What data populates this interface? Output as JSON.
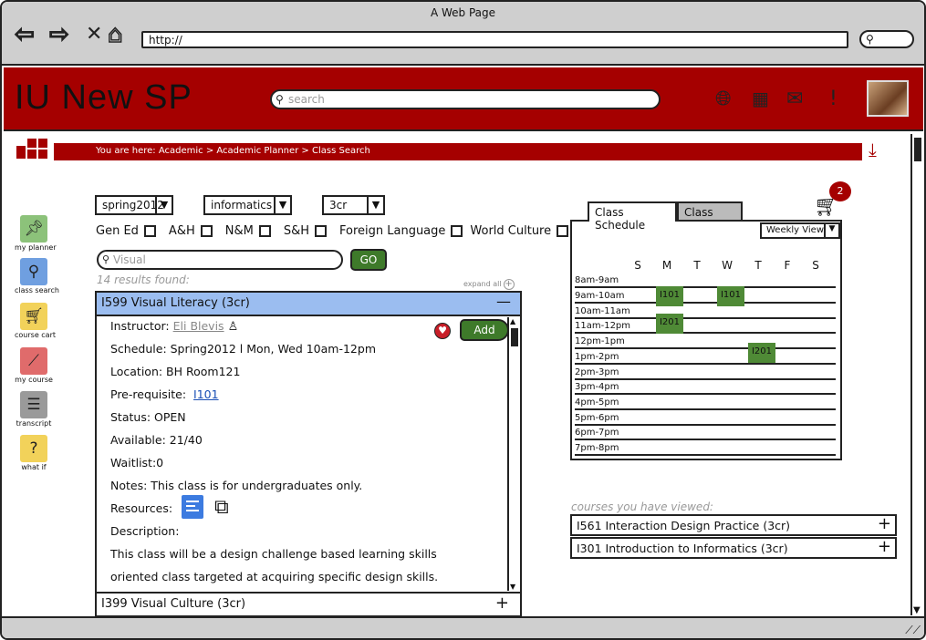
{
  "browser": {
    "window_title": "A Web Page",
    "url": "http://"
  },
  "header": {
    "app_title": "IU New SP",
    "search_placeholder": "search",
    "icons": [
      "globe-icon",
      "calendar-icon",
      "mail-icon",
      "alert-icon"
    ]
  },
  "breadcrumb": {
    "text": "You are here: Academic > Academic Planner > Class Search"
  },
  "sidebar": {
    "items": [
      {
        "label": "my planner",
        "icon": "pin-icon",
        "color": "#8cc27a"
      },
      {
        "label": "class search",
        "icon": "search-icon",
        "color": "#6f9fe0"
      },
      {
        "label": "course cart",
        "icon": "cart-icon",
        "color": "#f2d25a"
      },
      {
        "label": "my course",
        "icon": "chart-icon",
        "color": "#e06b6b"
      },
      {
        "label": "transcript",
        "icon": "list-icon",
        "color": "#9a9a9a"
      },
      {
        "label": "what if",
        "icon": "question-icon",
        "color": "#f2d25a"
      }
    ]
  },
  "filters": {
    "term": "spring2012",
    "department": "informatics",
    "credits": "3cr",
    "checkboxes": [
      "Gen Ed",
      "A&H",
      "N&M",
      "S&H",
      "Foreign Language",
      "World Culture"
    ],
    "search_placeholder": "Visual",
    "go_label": "GO",
    "results_count": "14 results found:",
    "expand_all": "expand all"
  },
  "course": {
    "title": "I599 Visual Literacy (3cr)",
    "instructor_label": "Instructor:",
    "instructor": "Eli Blevis",
    "schedule": "Schedule: Spring2012 l Mon, Wed 10am-12pm",
    "location": "Location: BH Room121",
    "prereq_label": "Pre-requisite:",
    "prereq": "I101",
    "status": "Status: OPEN",
    "available": "Available: 21/40",
    "waitlist": "Waitlist:0",
    "notes": "Notes: This class is for undergraduates only.",
    "resources_label": "Resources:",
    "description_label": "Description:",
    "description_line1": "This class will be a design challenge based learning skills",
    "description_line2": "oriented class targeted at acquiring specific design skills.",
    "add_label": "Add",
    "next_course": "I399 Visual Culture (3cr)"
  },
  "cart": {
    "count": "2"
  },
  "schedule": {
    "tab_active": "Class Schedule",
    "tab_inactive": "Class Map",
    "view": "Weekly View",
    "days": [
      "S",
      "M",
      "T",
      "W",
      "T",
      "F",
      "S"
    ],
    "times": [
      "8am-9am",
      "9am-10am",
      "10am-11am",
      "11am-12pm",
      "12pm-1pm",
      "1pm-2pm",
      "2pm-3pm",
      "3pm-4pm",
      "4pm-5pm",
      "5pm-6pm",
      "6pm-7pm",
      "7pm-8pm"
    ],
    "blocks": [
      {
        "label": "I101",
        "day": "M",
        "start": "9am"
      },
      {
        "label": "I101",
        "day": "W",
        "start": "9am"
      },
      {
        "label": "I201",
        "day": "M",
        "start": "11am"
      },
      {
        "label": "I201",
        "day": "T",
        "start": "12pm"
      }
    ]
  },
  "viewed": {
    "label": "courses you have viewed:",
    "items": [
      "I561 Interaction Design Practice (3cr)",
      "I301 Introduction to Informatics (3cr)"
    ]
  }
}
